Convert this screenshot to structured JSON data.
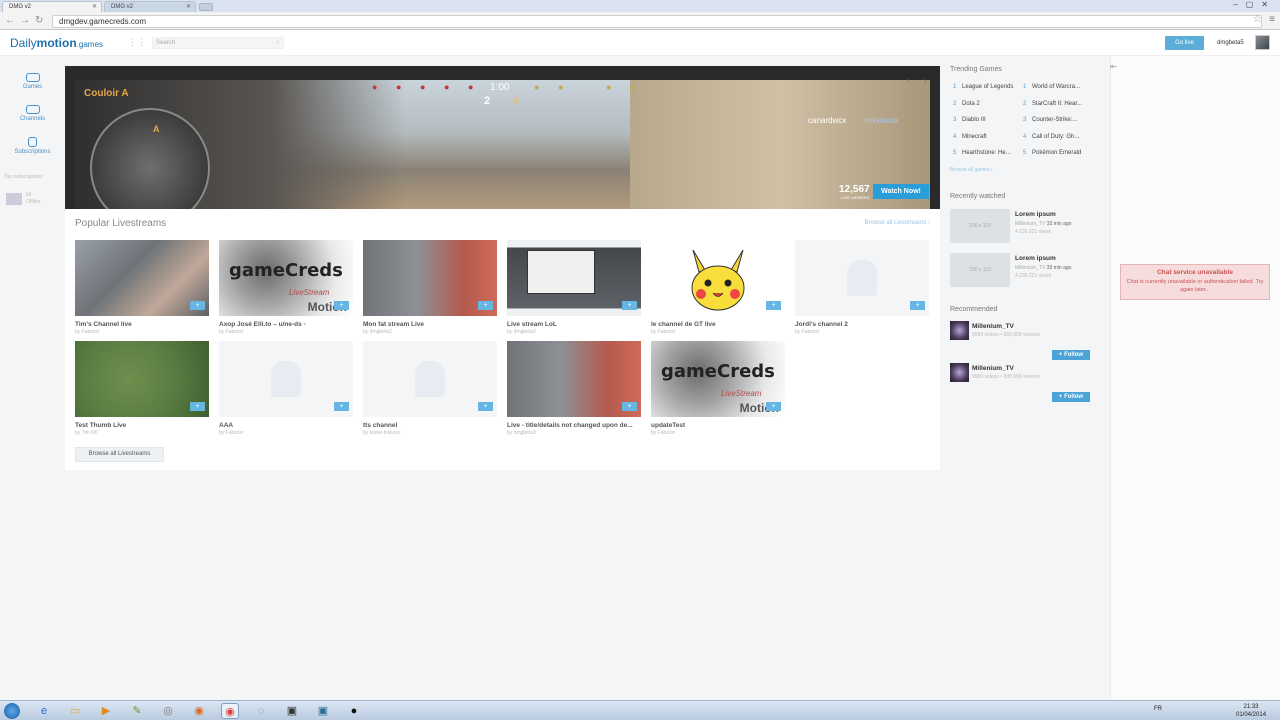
{
  "browser": {
    "tabs": [
      {
        "label": "DMG v2",
        "active": true
      },
      {
        "label": "DMG v2",
        "active": false
      }
    ],
    "url": "dmgdev.gamecreds.com"
  },
  "header": {
    "logo_main": "Daily",
    "logo_bold": "motion",
    "logo_sub": ".games",
    "search_placeholder": "Search",
    "golive_label": "Go live",
    "username": "dmgbeta5"
  },
  "left_nav": {
    "items": [
      {
        "label": "Games"
      },
      {
        "label": "Channels"
      },
      {
        "label": "Subscriptions"
      }
    ],
    "top_subs_label": "Top subscriptions",
    "user_name": "lol",
    "user_status": "Offline"
  },
  "hero": {
    "map_label": "Couloir A",
    "radar_marker": "A",
    "timer": "1:00",
    "score_ct": "2",
    "score_t": "4",
    "kill_attacker": "canardwcx",
    "kill_victim": "mikebeza",
    "viewer_count": "12,567",
    "viewer_label": "LIVE VIEWERS",
    "watch_label": "Watch Now!",
    "arrows": "‹ ›"
  },
  "popular": {
    "title": "Popular Livestreams",
    "browse_link": "Browse all Livestreams ›",
    "plus_label": "+",
    "items": [
      {
        "title": "Tim's Channel live",
        "by": "by Fabrizio",
        "thumb": "face"
      },
      {
        "title": "Axop José Elli.to – u/ne-ds -",
        "by": "by Fabrizio",
        "thumb": "gc"
      },
      {
        "title": "Mon fat stream Live",
        "by": "by dmgbeta2",
        "thumb": "bike"
      },
      {
        "title": "Live stream LoL",
        "by": "by dmgbeta3",
        "thumb": "lol"
      },
      {
        "title": "le channel de GT live",
        "by": "by Fabrizio",
        "thumb": "pika"
      },
      {
        "title": "Jordi's channel 2",
        "by": "by Fabrizio",
        "thumb": "empty"
      },
      {
        "title": "Test Thumb Live",
        "by": "by Tim NC",
        "thumb": "map"
      },
      {
        "title": "AAA",
        "by": "by Fabrizio",
        "thumb": "empty"
      },
      {
        "title": "tts channel",
        "by": "by tester-fraturez",
        "thumb": "empty"
      },
      {
        "title": "Live - title/details not changed upon de...",
        "by": "by dmgbeta3",
        "thumb": "bike"
      },
      {
        "title": "updateTest",
        "by": "by Fabrizio",
        "thumb": "gc"
      }
    ],
    "gc_text": "gameCreds",
    "gc_ls": "LiveStream",
    "gc_m": "Motion",
    "browse_button": "Browse all Livestreams"
  },
  "trending": {
    "title": "Trending Games",
    "items": [
      {
        "n": "1",
        "name": "League of Legends"
      },
      {
        "n": "1",
        "name": "World of Warcra..."
      },
      {
        "n": "2",
        "name": "Dota 2"
      },
      {
        "n": "2",
        "name": "StarCraft II: Hear..."
      },
      {
        "n": "3",
        "name": "Diablo III"
      },
      {
        "n": "3",
        "name": "Counter-Strike:..."
      },
      {
        "n": "4",
        "name": "Minecraft"
      },
      {
        "n": "4",
        "name": "Call of Duty: Gh..."
      },
      {
        "n": "5",
        "name": "Hearthstone: He..."
      },
      {
        "n": "5",
        "name": "Pokémon Emerald"
      }
    ],
    "browse_link": "Browse all games ›"
  },
  "recently_watched": {
    "title": "Recently watched",
    "items": [
      {
        "thumb": "230 x 119",
        "title": "Lorem ipsum",
        "channel": "Millenium_TV",
        "ago": "33 min ago",
        "views": "4 235 221 views"
      },
      {
        "thumb": "230 x 119",
        "title": "Lorem ipsum",
        "channel": "Millenium_TV",
        "ago": "33 min ago",
        "views": "4 235 221 views"
      }
    ]
  },
  "recommended": {
    "title": "Recommended",
    "items": [
      {
        "name": "Millenium_TV",
        "meta": "9999 videos  •  999,999 viewers",
        "follow": "+ Follow"
      },
      {
        "name": "Millenium_TV",
        "meta": "9999 videos  •  999,999 viewers",
        "follow": "+ Follow"
      }
    ]
  },
  "chat": {
    "handle": "⇤",
    "error_title": "Chat service unavailable",
    "error_msg": "Chat is currently unavailable or authentication failed. Try again later..."
  },
  "taskbar": {
    "tray_lang": "FR",
    "time": "21:33",
    "date": "01/04/2014"
  },
  "colors": {
    "accent": "#4ba3d8",
    "golive": "#5aaed8",
    "error_bg": "#f6dcdc",
    "error_text": "#c85555"
  }
}
